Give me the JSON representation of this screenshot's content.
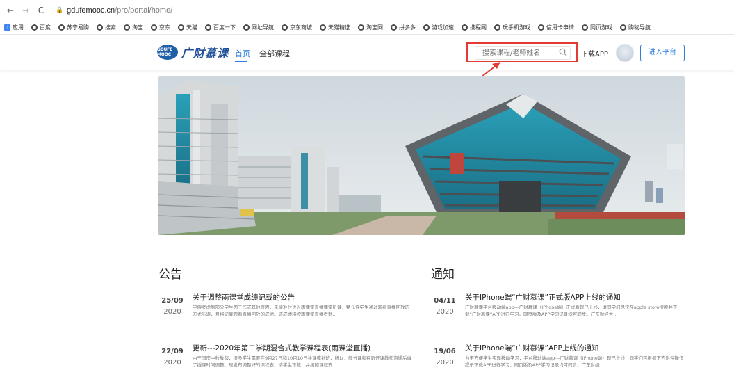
{
  "browser": {
    "url_domain": "gdufemooc.cn",
    "url_path": "/pro/portal/home/",
    "bookmarks": [
      "应用",
      "百度",
      "苏宁易购",
      "搜索",
      "淘宝",
      "京东",
      "天猫",
      "百度一下",
      "网址导航",
      "京东商城",
      "天猫精选",
      "淘宝网",
      "拼多多",
      "游戏加速",
      "携程网",
      "玩手机游戏",
      "信用卡申请",
      "网页游戏",
      "购物导航"
    ]
  },
  "header": {
    "logo_mark": "GDUFE MOOC",
    "logo_text": "广财慕课",
    "nav": {
      "home": "首页",
      "all_courses": "全部课程"
    },
    "search": {
      "placeholder": "搜索课程/老师姓名"
    },
    "download": "下载APP",
    "enter_platform": "进入平台"
  },
  "announcements": {
    "title": "公告",
    "items": [
      {
        "month_day": "25/09",
        "year": "2020",
        "title": "关于调整雨课堂成绩记载的公告",
        "desc": "学院考虑到部分学生因工作或其他原因，未能准时进入雨课堂直播课堂听课，特允许学生通过观看直播回放的方式听课，且将记载观看直播回放的成绩。该成绩将按雨课堂直播考勤..."
      },
      {
        "month_day": "22/09",
        "year": "2020",
        "title": "更新---2020年第二学期混合式教学课程表(雨课堂直播)",
        "desc": "由于国庆中秋放假，很多学生需要在9月27日和10月10日补课或补班，所以，部分课程在跟任课教师沟通后做了授课时间调整，现发布调整好的课程表，请学生下载，并按照课程安..."
      }
    ]
  },
  "notices": {
    "title": "通知",
    "items": [
      {
        "month_day": "04/11",
        "year": "2020",
        "title": "关于IPhone端“广财慕课”正式版APP上线的通知",
        "desc": "广财慕课平台移动端app---广财慕课（IPhone端）正式版现已上线，请同学们尽快在apple store搜索并下载“广财慕课”APP进行学习。网页版及APP学习记录均可同步。广东财经大..."
      },
      {
        "month_day": "19/06",
        "year": "2020",
        "title": "关于IPhone端“广财慕课”APP上线的通知",
        "desc": "为更方便学生实现移动学习，平台移动端app---广财慕课（IPhone端）现已上线，同学们可根据下方附件操作提示下载APP进行学习，网页版及APP学习记录均可同步。广东财经..."
      }
    ]
  },
  "colors": {
    "accent": "#2a7de1",
    "highlight": "#e53935"
  }
}
